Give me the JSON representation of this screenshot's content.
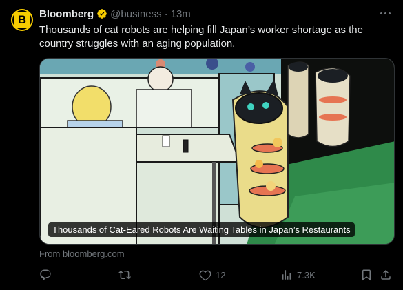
{
  "tweet": {
    "author_name": "Bloomberg",
    "handle": "@business",
    "separator": "·",
    "time": "13m",
    "avatar_letter": "B",
    "text": "Thousands of cat robots are helping fill Japan’s worker shortage as the country struggles with an aging population."
  },
  "media": {
    "caption": "Thousands of Cat-Eared Robots Are Waiting Tables in Japan’s Restaurants"
  },
  "source": "From bloomberg.com",
  "actions": {
    "reply": {
      "icon": "reply-icon",
      "count": ""
    },
    "retweet": {
      "icon": "retweet-icon",
      "count": ""
    },
    "like": {
      "icon": "heart-icon",
      "count": "12"
    },
    "views": {
      "icon": "views-icon",
      "count": "7.3K"
    },
    "bookmark": {
      "icon": "bookmark-icon"
    },
    "share": {
      "icon": "share-icon"
    }
  },
  "colors": {
    "background": "#000000",
    "text": "#e7e9ea",
    "muted": "#71767b",
    "brand": "#f7cc00",
    "verified": "#f7cc00"
  }
}
